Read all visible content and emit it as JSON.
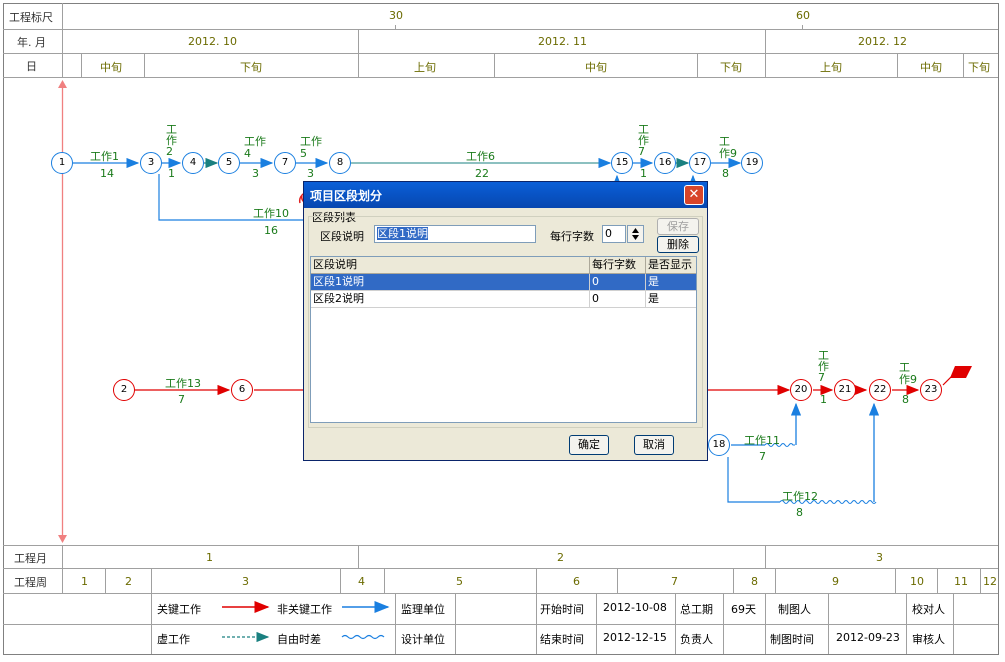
{
  "header": {
    "scale_label": "工程标尺",
    "scale_ticks": [
      "30",
      "60"
    ],
    "month_label": "年. 月",
    "months": [
      "2012. 10",
      "2012. 11",
      "2012. 12"
    ],
    "day_label": "日",
    "periods": [
      "中旬",
      "下旬",
      "上旬",
      "中旬",
      "下旬",
      "上旬",
      "中旬",
      "下旬"
    ]
  },
  "network": {
    "nodes": {
      "n1": "1",
      "n2": "2",
      "n3": "3",
      "n4": "4",
      "n5": "5",
      "n6": "6",
      "n7": "7",
      "n8": "8",
      "n15": "15",
      "n16": "16",
      "n17": "17",
      "n18": "18",
      "n19": "19",
      "n20": "20",
      "n21": "21",
      "n22": "22",
      "n23": "23"
    },
    "tasks": {
      "t1_name": "工作1",
      "t1_dur": "14",
      "t2_name": "工\n作\n2",
      "t2_dur": "1",
      "t4_name": "工作\n4",
      "t4_dur": "3",
      "t5_name": "工作\n5",
      "t5_dur": "3",
      "t6_name": "工作6",
      "t6_dur": "22",
      "t7_name": "工\n作\n7",
      "t7_dur": "1",
      "t9_name": "工\n作9",
      "t9_dur": "8",
      "t10_name": "工作10",
      "t10_dur": "16",
      "t13_name": "工作13",
      "t13_dur": "7",
      "t11_name": "工作11",
      "t11_dur": "7",
      "t12_name": "工作12",
      "t12_dur": "8",
      "t7b_name": "工\n作\n7",
      "t7b_dur": "1",
      "t9b_name": "工\n作9",
      "t9b_dur": "8"
    }
  },
  "footer": {
    "month_label": "工程月",
    "months": [
      "1",
      "2",
      "3"
    ],
    "week_label": "工程周",
    "weeks": [
      "1",
      "2",
      "3",
      "4",
      "5",
      "6",
      "7",
      "8",
      "9",
      "10",
      "11",
      "12"
    ]
  },
  "legend": {
    "critical": "关键工作",
    "noncritical": "非关键工作",
    "dummy": "虚工作",
    "float": "自由时差",
    "supervisor_label": "监理单位",
    "designer_label": "设计单位",
    "start_label": "开始时间",
    "start_value": "2012-10-08",
    "end_label": "结束时间",
    "end_value": "2012-12-15",
    "duration_label": "总工期",
    "duration_value": "69天",
    "owner_label": "负责人",
    "drawer_label": "制图人",
    "draw_time_label": "制图时间",
    "draw_time_value": "2012-09-23",
    "checker_label": "校对人",
    "reviewer_label": "审核人"
  },
  "dialog": {
    "title": "项目区段划分",
    "close_symbol": "✕",
    "group_label": "区段列表",
    "desc_label": "区段说明",
    "desc_value": "区段1说明",
    "chars_label": "每行字数",
    "chars_value": "0",
    "save_button": "保存",
    "delete_button": "删除",
    "columns": [
      "区段说明",
      "每行字数",
      "是否显示"
    ],
    "rows": [
      {
        "desc": "区段1说明",
        "chars": "0",
        "show": "是"
      },
      {
        "desc": "区段2说明",
        "chars": "0",
        "show": "是"
      }
    ],
    "ok_button": "确定",
    "cancel_button": "取消"
  },
  "colors": {
    "critical": "#e00000",
    "noncritical": "#1a7fe0",
    "dummy_arrow": "#1a8080",
    "label_green": "#1a7a1a",
    "title_bar": "#0a5fd8",
    "selection": "#316ac5"
  }
}
